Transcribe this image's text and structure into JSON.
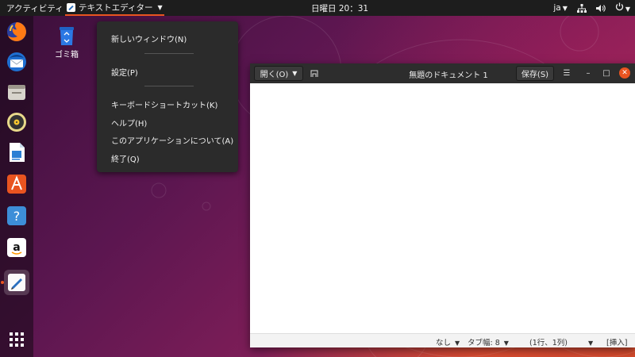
{
  "topbar": {
    "activities": "アクティビティ",
    "app_name": "テキストエディター",
    "clock": "日曜日 20：31",
    "lang": "ja"
  },
  "desktop": {
    "trash_label": "ゴミ箱"
  },
  "dock": {
    "items": [
      "firefox-icon",
      "thunderbird-icon",
      "files-icon",
      "rhythmbox-icon",
      "libreoffice-writer-icon",
      "ubuntu-software-icon",
      "help-icon",
      "amazon-icon",
      "text-editor-icon",
      "show-apps-icon"
    ]
  },
  "menu": {
    "new_window": "新しいウィンドウ(N)",
    "preferences": "設定(P)",
    "shortcuts": "キーボードショートカット(K)",
    "help": "ヘルプ(H)",
    "about": "このアプリケーションについて(A)",
    "quit": "終了(Q)"
  },
  "window": {
    "open_label": "開く(O)",
    "title": "無題のドキュメント 1",
    "save_label": "保存(S)",
    "status": {
      "lang": "なし",
      "tab_width": "タブ幅: 8",
      "position": "(1行、1列)",
      "mode": "[挿入]"
    }
  },
  "colors": {
    "accent": "#e95420",
    "panel": "#1d1d1d",
    "headerbar": "#2d2d2d"
  }
}
